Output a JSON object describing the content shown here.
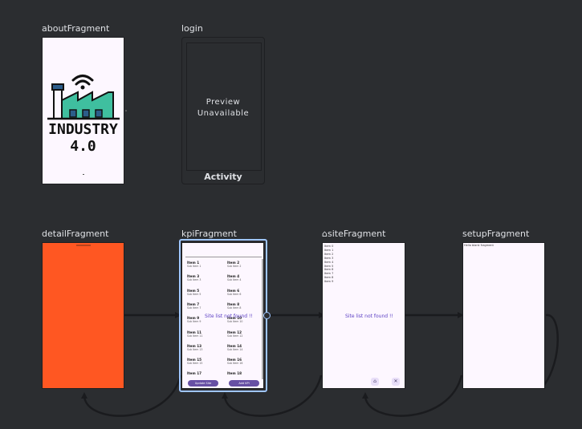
{
  "destinations": {
    "about": {
      "label": "aboutFragment",
      "logo_text_1": "INDUSTRY",
      "logo_text_2": "4.0"
    },
    "login": {
      "label": "login",
      "preview_line1": "Preview",
      "preview_line2": "Unavailable",
      "type": "Activity"
    },
    "detail": {
      "label": "detailFragment",
      "color": "#ff5722"
    },
    "kpi": {
      "label": "kpiFragment",
      "not_found": "Site list not found !!",
      "items": [
        {
          "t": "Item 1",
          "s": "Sub Item 1"
        },
        {
          "t": "Item 2",
          "s": "Sub Item 2"
        },
        {
          "t": "Item 3",
          "s": "Sub Item 3"
        },
        {
          "t": "Item 4",
          "s": "Sub Item 4"
        },
        {
          "t": "Item 5",
          "s": "Sub Item 5"
        },
        {
          "t": "Item 6",
          "s": "Sub Item 6"
        },
        {
          "t": "Item 7",
          "s": "Sub Item 7"
        },
        {
          "t": "Item 8",
          "s": "Sub Item 8"
        },
        {
          "t": "Item 9",
          "s": "Sub Item 9"
        },
        {
          "t": "Item 10",
          "s": "Sub Item 10"
        },
        {
          "t": "Item 11",
          "s": "Sub Item 11"
        },
        {
          "t": "Item 12",
          "s": "Sub Item 12"
        },
        {
          "t": "Item 13",
          "s": "Sub Item 13"
        },
        {
          "t": "Item 14",
          "s": "Sub Item 14"
        },
        {
          "t": "Item 15",
          "s": "Sub Item 15"
        },
        {
          "t": "Item 16",
          "s": "Sub Item 16"
        },
        {
          "t": "Item 17",
          "s": ""
        },
        {
          "t": "Item 18",
          "s": ""
        }
      ],
      "button_left": "Update Site",
      "button_right": "Add KPI"
    },
    "site": {
      "label": "siteFragment",
      "not_found": "Site list not found !!",
      "items": [
        "Item 0",
        "Item 1",
        "Item 2",
        "Item 3",
        "Item 4",
        "Item 5",
        "Item 6",
        "Item 7",
        "Item 8",
        "Item 9"
      ]
    },
    "setup": {
      "label": "setupFragment",
      "placeholder": "Hello blank fragment"
    }
  },
  "colors": {
    "canvas": "#2b2d30",
    "accent": "#6750a4",
    "selection": "#9fc6ff",
    "detail": "#ff5722"
  }
}
